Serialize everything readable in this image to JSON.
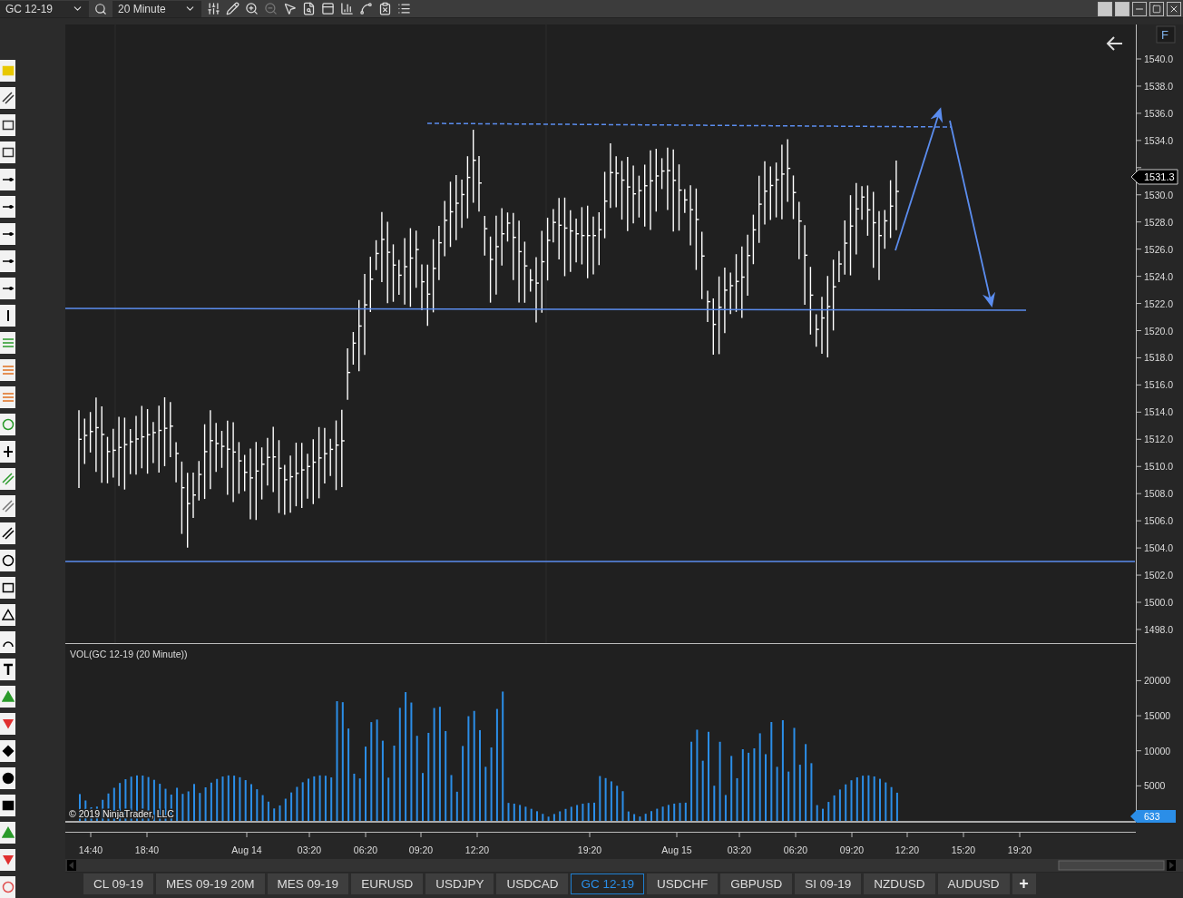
{
  "toolbar": {
    "instrument": "GC 12-19",
    "interval": "20 Minute"
  },
  "chart": {
    "price_axis": [
      "1540.0",
      "1538.0",
      "1536.0",
      "1534.0",
      "1530.0",
      "1528.0",
      "1526.0",
      "1524.0",
      "1522.0",
      "1520.0",
      "1518.0",
      "1516.0",
      "1514.0",
      "1512.0",
      "1510.0",
      "1508.0",
      "1506.0",
      "1504.0",
      "1502.0",
      "1500.0",
      "1498.0"
    ],
    "last_price": "1531.3",
    "indicator_label": "VOL(GC 12-19 (20 Minute))",
    "volume_axis": [
      "20000",
      "15000",
      "10000",
      "5000"
    ],
    "last_volume": "633",
    "copyright": "© 2019 NinjaTrader, LLC",
    "time_axis": [
      "14:40",
      "18:40",
      "Aug 14",
      "03:20",
      "06:20",
      "09:20",
      "12:20",
      "19:20",
      "Aug 15",
      "03:20",
      "06:20",
      "09:20",
      "12:20",
      "15:20",
      "19:20"
    ],
    "format_button": "F"
  },
  "tabs": [
    {
      "label": "CL 09-19",
      "selected": false
    },
    {
      "label": "MES 09-19 20M",
      "selected": false
    },
    {
      "label": "MES 09-19",
      "selected": false
    },
    {
      "label": "EURUSD",
      "selected": false
    },
    {
      "label": "USDJPY",
      "selected": false
    },
    {
      "label": "USDCAD",
      "selected": false
    },
    {
      "label": "GC 12-19",
      "selected": true
    },
    {
      "label": "USDCHF",
      "selected": false
    },
    {
      "label": "GBPUSD",
      "selected": false
    },
    {
      "label": "SI 09-19",
      "selected": false
    },
    {
      "label": "NZDUSD",
      "selected": false
    },
    {
      "label": "AUDUSD",
      "selected": false
    }
  ],
  "add_tab": "+"
}
